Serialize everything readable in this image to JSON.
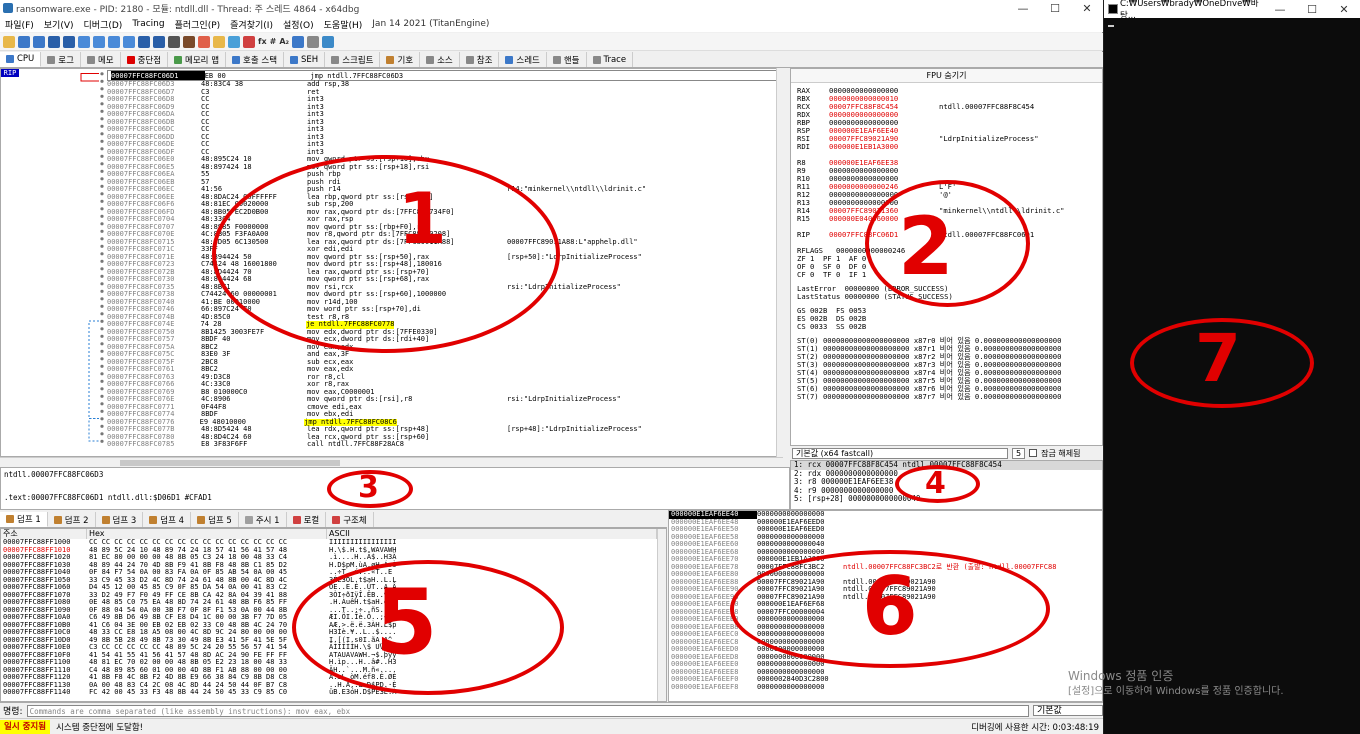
{
  "window": {
    "title": "ransomware.exe - PID: 2180 - 모듈: ntdll.dll - Thread: 주 스레드 4864 - x64dbg",
    "minimize": "—",
    "maximize": "☐",
    "close": "✕"
  },
  "menu": [
    "파일(F)",
    "보기(V)",
    "디버그(D)",
    "Tracing",
    "플러그인(P)",
    "즐겨찾기(I)",
    "설정(O)",
    "도움말(H)",
    "Jan 14 2021 (TitanEngine)"
  ],
  "toolbar": {
    "fx": "fx",
    "hash": "#",
    "az": "A₂"
  },
  "tabs": [
    {
      "label": "CPU",
      "color": "#3c78c8"
    },
    {
      "label": "로그",
      "color": "#888"
    },
    {
      "label": "메모",
      "color": "#888"
    },
    {
      "label": "중단점",
      "color": "#d00"
    },
    {
      "label": "메모리 맵",
      "color": "#4a9a4a"
    },
    {
      "label": "호출 스택",
      "color": "#3c78c8"
    },
    {
      "label": "SEH",
      "color": "#3c78c8"
    },
    {
      "label": "스크립트",
      "color": "#888"
    },
    {
      "label": "기호",
      "color": "#c08030"
    },
    {
      "label": "소스",
      "color": "#888"
    },
    {
      "label": "참조",
      "color": "#888"
    },
    {
      "label": "스레드",
      "color": "#3c78c8"
    },
    {
      "label": "핸들",
      "color": "#888"
    },
    {
      "label": "Trace",
      "color": "#888"
    }
  ],
  "disasm": {
    "rip_label": "RIP",
    "rows": [
      {
        "a": "00007FFC88FC06D1",
        "b": "EB 00",
        "i": "jmp ntdll.7FFC88FC06D3",
        "c": "",
        "sel": true
      },
      {
        "a": "00007FFC88FC06D3",
        "b": "48:83C4 38",
        "i": "add rsp,38",
        "c": ""
      },
      {
        "a": "00007FFC88FC06D7",
        "b": "C3",
        "i": "ret",
        "c": ""
      },
      {
        "a": "00007FFC88FC06D8",
        "b": "CC",
        "i": "int3",
        "c": ""
      },
      {
        "a": "00007FFC88FC06D9",
        "b": "CC",
        "i": "int3",
        "c": ""
      },
      {
        "a": "00007FFC88FC06DA",
        "b": "CC",
        "i": "int3",
        "c": ""
      },
      {
        "a": "00007FFC88FC06DB",
        "b": "CC",
        "i": "int3",
        "c": ""
      },
      {
        "a": "00007FFC88FC06DC",
        "b": "CC",
        "i": "int3",
        "c": ""
      },
      {
        "a": "00007FFC88FC06DD",
        "b": "CC",
        "i": "int3",
        "c": ""
      },
      {
        "a": "00007FFC88FC06DE",
        "b": "CC",
        "i": "int3",
        "c": ""
      },
      {
        "a": "00007FFC88FC06DF",
        "b": "CC",
        "i": "int3",
        "c": ""
      },
      {
        "a": "00007FFC88FC06E0",
        "b": "48:895C24 10",
        "i": "mov qword ptr ss:[rsp+10],rbx",
        "c": ""
      },
      {
        "a": "00007FFC88FC06E5",
        "b": "48:897424 18",
        "i": "mov qword ptr ss:[rsp+18],rsi",
        "c": ""
      },
      {
        "a": "00007FFC88FC06EA",
        "b": "55",
        "i": "push rbp",
        "c": ""
      },
      {
        "a": "00007FFC88FC06EB",
        "b": "57",
        "i": "push rdi",
        "c": ""
      },
      {
        "a": "00007FFC88FC06EC",
        "b": "41:56",
        "i": "push r14",
        "c": "r14:\"minkernel\\\\ntdll\\\\ldrinit.c\""
      },
      {
        "a": "00007FFC88FC06EE",
        "b": "48:8DAC24 00FFFFFF",
        "i": "lea rbp,qword ptr ss:[rsp-100]",
        "c": ""
      },
      {
        "a": "00007FFC88FC06F6",
        "b": "48:81EC 00020000",
        "i": "sub rsp,200",
        "c": ""
      },
      {
        "a": "00007FFC88FC06FD",
        "b": "48:8B05 EC2D0B00",
        "i": "mov rax,qword ptr ds:[7FFC890734F0]",
        "c": ""
      },
      {
        "a": "00007FFC88FC0704",
        "b": "48:33C4",
        "i": "xor rax,rsp",
        "c": ""
      },
      {
        "a": "00007FFC88FC0707",
        "b": "48:8985 F0000000",
        "i": "mov qword ptr ss:[rbp+F0],rax",
        "c": ""
      },
      {
        "a": "00007FFC88FC070E",
        "b": "4C:8B05 F3FA0A00",
        "i": "mov r8,qword ptr ds:[7FFC89070208]",
        "c": ""
      },
      {
        "a": "00007FFC88FC0715",
        "b": "48:8D05 6C130500",
        "i": "lea rax,qword ptr ds:[7FFC89011A88]",
        "c": "00007FFC89011A88:L\"apphelp.dll\""
      },
      {
        "a": "00007FFC88FC071C",
        "b": "33FF",
        "i": "xor edi,edi",
        "c": ""
      },
      {
        "a": "00007FFC88FC071E",
        "b": "48:894424 50",
        "i": "mov qword ptr ss:[rsp+50],rax",
        "c": "[rsp+50]:\"LdrpInitializeProcess\""
      },
      {
        "a": "00007FFC88FC0723",
        "b": "C74424 48 16001800",
        "i": "mov dword ptr ss:[rsp+48],180016",
        "c": ""
      },
      {
        "a": "00007FFC88FC072B",
        "b": "48:8D4424 70",
        "i": "lea rax,qword ptr ss:[rsp+70]",
        "c": ""
      },
      {
        "a": "00007FFC88FC0730",
        "b": "48:894424 68",
        "i": "mov qword ptr ss:[rsp+68],rax",
        "c": ""
      },
      {
        "a": "00007FFC88FC0735",
        "b": "48:8BF1",
        "i": "mov rsi,rcx",
        "c": "rsi:\"LdrpInitializeProcess\""
      },
      {
        "a": "00007FFC88FC0738",
        "b": "C74424 60 00000001",
        "i": "mov dword ptr ss:[rsp+60],1000000",
        "c": ""
      },
      {
        "a": "00007FFC88FC0740",
        "b": "41:BE 00010000",
        "i": "mov r14d,100",
        "c": ""
      },
      {
        "a": "00007FFC88FC0746",
        "b": "66:897C24 70",
        "i": "mov word ptr ss:[rsp+70],di",
        "c": ""
      },
      {
        "a": "00007FFC88FC074B",
        "b": "4D:85C0",
        "i": "test r8,r8",
        "c": ""
      },
      {
        "a": "00007FFC88FC074E",
        "b": "74 28",
        "i": "je ntdll.7FFC88FC0778",
        "c": "",
        "jmp": true
      },
      {
        "a": "00007FFC88FC0750",
        "b": "8B1425 3003FE7F",
        "i": "mov edx,dword ptr ds:[7FFE0330]",
        "c": ""
      },
      {
        "a": "00007FFC88FC0757",
        "b": "8BDF 40",
        "i": "mov ecx,dword ptr ds:[rdi+40]",
        "c": ""
      },
      {
        "a": "00007FFC88FC075A",
        "b": "8BC2",
        "i": "mov eax,edx",
        "c": ""
      },
      {
        "a": "00007FFC88FC075C",
        "b": "83E0 3F",
        "i": "and eax,3F",
        "c": ""
      },
      {
        "a": "00007FFC88FC075F",
        "b": "2BC8",
        "i": "sub ecx,eax",
        "c": ""
      },
      {
        "a": "00007FFC88FC0761",
        "b": "8BC2",
        "i": "mov eax,edx",
        "c": ""
      },
      {
        "a": "00007FFC88FC0763",
        "b": "49:D3C8",
        "i": "ror r8,cl",
        "c": ""
      },
      {
        "a": "00007FFC88FC0766",
        "b": "4C:33C0",
        "i": "xor r8,rax",
        "c": ""
      },
      {
        "a": "00007FFC88FC0769",
        "b": "B8 010000C0",
        "i": "mov eax,C0000001",
        "c": ""
      },
      {
        "a": "00007FFC88FC076E",
        "b": "4C:8906",
        "i": "mov qword ptr ds:[rsi],r8",
        "c": "rsi:\"LdrpInitializeProcess\""
      },
      {
        "a": "00007FFC88FC0771",
        "b": "0F44F8",
        "i": "cmove edi,eax",
        "c": ""
      },
      {
        "a": "00007FFC88FC0774",
        "b": "8BDF",
        "i": "mov ebx,edi",
        "c": ""
      },
      {
        "a": "00007FFC88FC0776",
        "b": "E9 48010000",
        "i": "jmp ntdll.7FFC88FC08C6",
        "c": "",
        "jmp": true
      },
      {
        "a": "00007FFC88FC077B",
        "b": "48:8D5424 48",
        "i": "lea rdx,qword ptr ss:[rsp+48]",
        "c": "[rsp+48]:\"LdrpInitializeProcess\""
      },
      {
        "a": "00007FFC88FC0780",
        "b": "48:8D4C24 60",
        "i": "lea rcx,qword ptr ss:[rsp+60]",
        "c": ""
      },
      {
        "a": "00007FFC88FC0785",
        "b": "E8 3F83F6FF",
        "i": "call ntdll.7FFC88F28AC8",
        "c": ""
      }
    ]
  },
  "info": {
    "line1": "ntdll.00007FFC88FC06D3",
    "line2": ".text:00007FFC88FC06D1 ntdll.dll:$D06D1 #CFAD1"
  },
  "regs": {
    "header": "FPU 숨기기",
    "gp": [
      {
        "n": "RAX",
        "v": "0000000000000000",
        "c": "",
        "r": false
      },
      {
        "n": "RBX",
        "v": "0000000000000010",
        "c": "",
        "r": true
      },
      {
        "n": "RCX",
        "v": "00007FFC88F8C454",
        "c": "ntdll.00007FFC88F8C454",
        "r": true
      },
      {
        "n": "RDX",
        "v": "0000000000000000",
        "c": "",
        "r": true
      },
      {
        "n": "RBP",
        "v": "0000000000000000",
        "c": "",
        "r": false
      },
      {
        "n": "RSP",
        "v": "000000E1EAF6EE40",
        "c": "",
        "r": true
      },
      {
        "n": "RSI",
        "v": "00007FFC89021A90",
        "c": "\"LdrpInitializeProcess\"",
        "r": true
      },
      {
        "n": "RDI",
        "v": "000000E1EB1A3000",
        "c": "",
        "r": true
      }
    ],
    "ext": [
      {
        "n": "R8",
        "v": "000000E1EAF6EE38",
        "c": "",
        "r": true
      },
      {
        "n": "R9",
        "v": "0000000000000000",
        "c": "",
        "r": false
      },
      {
        "n": "R10",
        "v": "0000000000000000",
        "c": "",
        "r": false
      },
      {
        "n": "R11",
        "v": "0000000000000246",
        "c": "L'F'",
        "r": true
      },
      {
        "n": "R12",
        "v": "0000000000000000",
        "c": "'@'",
        "r": false
      },
      {
        "n": "R13",
        "v": "0000000000000000",
        "c": "",
        "r": false
      },
      {
        "n": "R14",
        "v": "00007FFC89021360",
        "c": "\"minkernel\\\\ntdll\\\\ldrinit.c\"",
        "r": true
      },
      {
        "n": "R15",
        "v": "000000E040360000",
        "c": "",
        "r": true
      }
    ],
    "rip": {
      "n": "RIP",
      "v": "00007FFC88FC06D1",
      "c": "ntdll.00007FFC88FC06D1"
    },
    "rflags": "RFLAGS   0000000000000246",
    "flags": [
      "ZF 1  PF 1  AF 0",
      "OF 0  SF 0  DF 0",
      "CF 0  TF 0  IF 1"
    ],
    "last": [
      "LastError  00000000 (ERROR_SUCCESS)",
      "LastStatus 00000000 (STATUS_SUCCESS)"
    ],
    "seg": [
      "GS 002B  FS 0053",
      "ES 002B  DS 002B",
      "CS 0033  SS 002B"
    ],
    "fpu": [
      "ST(0) 00000000000000000000 x87r0 비어 있음 0.000000000000000000",
      "ST(1) 00000000000000000000 x87r1 비어 있음 0.000000000000000000",
      "ST(2) 00000000000000000000 x87r2 비어 있음 0.000000000000000000",
      "ST(3) 00000000000000000000 x87r3 비어 있음 0.000000000000000000",
      "ST(4) 00000000000000000000 x87r4 비어 있음 0.000000000000000000",
      "ST(5) 00000000000000000000 x87r5 비어 있음 0.000000000000000000",
      "ST(6) 00000000000000000000 x87r6 비어 있음 0.000000000000000000",
      "ST(7) 00000000000000000000 x87r7 비어 있음 0.000000000000000000"
    ]
  },
  "callconv": {
    "label": "기본값 (x64 fastcall)",
    "count": "5",
    "unlock": "잠금 해제됨"
  },
  "args": [
    "1: rcx 00007FFC88F8C454 ntdll.00007FFC88F8C454",
    "2: rdx 0000000000000000",
    "3: r8 000000E1EAF6EE38",
    "4: r9 0000000000000000",
    "5: [rsp+28] 0000000000000040"
  ],
  "dumptabs": [
    "덤프 1",
    "덤프 2",
    "덤프 3",
    "덤프 4",
    "덤프 5",
    "주시 1",
    "로컬",
    "구조체"
  ],
  "dump": {
    "headers": {
      "addr": "주소",
      "hex": "Hex",
      "ascii": "ASCII"
    },
    "rows": [
      {
        "a": "00007FFC88FF1000",
        "h": "CC CC CC CC CC CC CC CC CC CC CC CC CC CC CC CC",
        "s": "ÌÌÌÌÌÌÌÌÌÌÌÌÌÌÌÌ",
        "r": false
      },
      {
        "a": "00007FFC88FF1010",
        "h": "48 89 5C 24 10 48 89 74 24 18 57 41 56 41 57 48",
        "s": "H.\\$.H.t$.WAVAWH",
        "r": true
      },
      {
        "a": "00007FFC88FF1020",
        "h": "81 EC 80 00 00 00 48 8B 05 C3 24 18 00 48 33 C4",
        "s": ".ì....H..Ã$..H3Ä",
        "r": false
      },
      {
        "a": "00007FFC88FF1030",
        "h": "48 89 44 24 70 4D 8B F9 41 8B F8 48 8B C1 85 D2",
        "s": "H.D$pM.ùA.øH.Á.Ò",
        "r": false
      },
      {
        "a": "00007FFC88FF1040",
        "h": "0F 84 F7 54 0A 00 83 FA 0A 0F 85 AB 54 0A 00 45",
        "s": "..÷T..ú...«T..E",
        "r": false
      },
      {
        "a": "00007FFC88FF1050",
        "h": "33 C9 45 33 D2 4C 8D 74 24 61 48 8B 00 4C 8D 4C",
        "s": "3ÉE3ÒL.t$aH..L.L",
        "r": false
      },
      {
        "a": "00007FFC88FF1060",
        "h": "D4 45 12 00 45 85 C9 0F 85 DA 54 0A 00 41 83 C2",
        "s": "ÔE..E.É..ÚT..A.Â",
        "r": false
      },
      {
        "a": "00007FFC88FF1070",
        "h": "33 D2 49 F7 F0 49 FF CE 8B CA 42 8A 04 39 41 88",
        "s": "3ÒI÷ðIÿÎ.ÊB..9A.",
        "r": false
      },
      {
        "a": "00007FFC88FF1080",
        "h": "0E 48 85 C0 75 EA 48 8D 74 24 61 48 8B F6 85 FF",
        "s": ".H.ÀuêH.t$aH.ö.ÿ",
        "r": false
      },
      {
        "a": "00007FFC88FF1090",
        "h": "0F 88 04 54 0A 00 3B F7 0F 8F F1 53 0A 00 44 8B",
        "s": "...T..;÷..ñS..D.",
        "r": false
      },
      {
        "a": "00007FFC88FF10A0",
        "h": "C6 49 8B D6 49 8B CF E8 D4 1C 00 00 3B F7 7D 05",
        "s": "ÆI.ÖI.Ïè.Ô..;÷}.",
        "r": false
      },
      {
        "a": "00007FFC88FF10B0",
        "h": "41 C6 04 3E 00 EB 02 EB 02 33 C0 48 8B 4C 24 70",
        "s": "AÆ.>.ë.ë.3ÀH.L$p",
        "r": false
      },
      {
        "a": "00007FFC88FF10C0",
        "h": "48 33 CC E8 18 A5 08 00 4C 8D 9C 24 80 00 00 00",
        "s": "H3Ìè.¥..L..$....",
        "r": false
      },
      {
        "a": "00007FFC88FF10D0",
        "h": "49 8B 5B 28 49 8B 73 30 49 8B E3 41 5F 41 5E 5F",
        "s": "I.[(I.s0I.ãA_A^_",
        "r": false
      },
      {
        "a": "00007FFC88FF10E0",
        "h": "C3 CC CC CC CC CC 48 89 5C 24 20 55 56 57 41 54",
        "s": "ÃÌÌÌÌÌH.\\$ UVWAT",
        "r": false
      },
      {
        "a": "00007FFC88FF10F0",
        "h": "41 54 41 55 41 56 41 57 48 8D AC 24 90 FE FF FF",
        "s": "ATAUAVAWH.¬$.þÿÿ",
        "r": false
      },
      {
        "a": "00007FFC88FF1100",
        "h": "48 81 EC 70 02 00 00 48 8B 05 E2 23 18 00 48 33",
        "s": "H.ìp...H..â#..H3",
        "r": false
      },
      {
        "a": "00007FFC88FF1110",
        "h": "C4 48 89 85 60 01 00 00 4D 8B F1 AB 88 00 00 00",
        "s": "ÄH..`...M.ñ«....",
        "r": false
      },
      {
        "a": "00007FFC88FF1120",
        "h": "41 8B F8 4C 8B F2 4D 8B E9 66 38 84 C9 8B D8 C8",
        "s": "A.øL.òM.éf8.É.ØÈ",
        "r": false
      },
      {
        "a": "00007FFC88FF1130",
        "h": "0A 00 48 83 C4 2C 08 4C 8D 44 24 50 44 0F B7 C8",
        "s": "..H.Ä,.L.D$PD.·È",
        "r": false
      },
      {
        "a": "00007FFC88FF1140",
        "h": "FC 42 00 45 33 F3 48 8B 44 24 50 45 33 C9 85 C0",
        "s": "üB.E3óH.D$PE3É.À",
        "r": false
      }
    ]
  },
  "stack": {
    "rows": [
      {
        "a": "000000E1EAF6EE40",
        "v": "0000000000000000",
        "c": "",
        "sel": true,
        "r": false
      },
      {
        "a": "000000E1EAF6EE48",
        "v": "000000E1EAF6EED0",
        "c": "",
        "r": false
      },
      {
        "a": "000000E1EAF6EE50",
        "v": "000000E1EAF6EED0",
        "c": "",
        "r": false
      },
      {
        "a": "000000E1EAF6EE58",
        "v": "0000000000000000",
        "c": "",
        "r": false
      },
      {
        "a": "000000E1EAF6EE60",
        "v": "0000000000000040",
        "c": "",
        "r": false
      },
      {
        "a": "000000E1EAF6EE68",
        "v": "0000000000000000",
        "c": "",
        "r": false
      },
      {
        "a": "000000E1EAF6EE70",
        "v": "000000E1EB1A3000",
        "c": "",
        "r": false
      },
      {
        "a": "000000E1EAF6EE78",
        "v": "00007FFC88FC3BC2",
        "c": "ntdll.00007FFC88FC3BC2로 반환 (출발: ntdll.00007FFC88",
        "r": true
      },
      {
        "a": "000000E1EAF6EE80",
        "v": "0000000000000000",
        "c": "",
        "r": false
      },
      {
        "a": "000000E1EAF6EE88",
        "v": "00007FFC89021A90",
        "c": "ntdll.00007FFC89021A90",
        "r": false
      },
      {
        "a": "000000E1EAF6EE90",
        "v": "00007FFC89021A90",
        "c": "ntdll.00007FFC89021A90",
        "r": false
      },
      {
        "a": "000000E1EAF6EE98",
        "v": "00007FFC89021A90",
        "c": "ntdll.00007FFC89021A90",
        "r": false
      },
      {
        "a": "000000E1EAF6EEA0",
        "v": "000000E1EAF6EF68",
        "c": "",
        "r": false
      },
      {
        "a": "000000E1EAF6EEA8",
        "v": "00007FFC00000004",
        "c": "",
        "r": false
      },
      {
        "a": "000000E1EAF6EEB0",
        "v": "0000000000000000",
        "c": "",
        "r": false
      },
      {
        "a": "000000E1EAF6EEB8",
        "v": "0000000000000000",
        "c": "",
        "r": false
      },
      {
        "a": "000000E1EAF6EEC0",
        "v": "0000000000000000",
        "c": "",
        "r": false
      },
      {
        "a": "000000E1EAF6EEC8",
        "v": "0000000000000000",
        "c": "",
        "r": false
      },
      {
        "a": "000000E1EAF6EED0",
        "v": "0000000000000000",
        "c": "",
        "r": false
      },
      {
        "a": "000000E1EAF6EED8",
        "v": "0000000000000000",
        "c": "",
        "r": false
      },
      {
        "a": "000000E1EAF6EEE0",
        "v": "0000000000000000",
        "c": "",
        "r": false
      },
      {
        "a": "000000E1EAF6EEE8",
        "v": "0000000000000000",
        "c": "",
        "r": false
      },
      {
        "a": "000000E1EAF6EEF0",
        "v": "0000002840D3C2800",
        "c": "",
        "r": false
      },
      {
        "a": "000000E1EAF6EEF8",
        "v": "0000000000000000",
        "c": "",
        "r": false
      }
    ]
  },
  "command": {
    "label": "명령:",
    "placeholder": "Commands are comma separated (like assembly instructions): mov eax, ebx",
    "default": "기본값"
  },
  "status": {
    "paused": "일시 중지됨",
    "message": "시스템 중단점에 도달함!",
    "elapsed": "디버깅에 사용한 시간: 0:03:48:19"
  },
  "console": {
    "title": "C:₩Users₩brady₩OneDrive₩바탕...",
    "minimize": "—",
    "maximize": "☐",
    "close": "✕"
  },
  "watermark": {
    "line1": "Windows 정품 인증",
    "line2": "[설정]으로 이동하여 Windows를 정품 인증합니다."
  },
  "annotations": [
    "1",
    "2",
    "3",
    "4",
    "5",
    "6",
    "7"
  ],
  "colors": {
    "annotation": "#e10000",
    "rip_bg": "#0000c0",
    "paused_bg": "#ffff00",
    "reg_changed": "#e00000"
  }
}
